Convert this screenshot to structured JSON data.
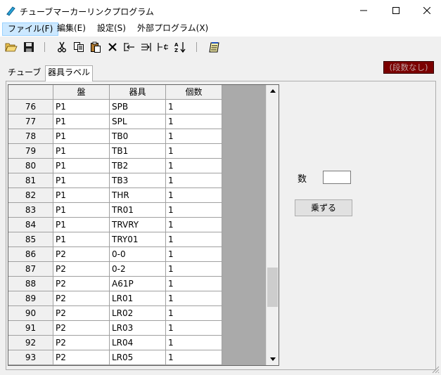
{
  "window": {
    "title": "チューブマーカーリンクプログラム"
  },
  "menu": [
    {
      "label": "ファイル(F)",
      "active": true
    },
    {
      "label": "編集(E)",
      "active": false
    },
    {
      "label": "設定(S)",
      "active": false
    },
    {
      "label": "外部プログラム(X)",
      "active": false
    }
  ],
  "toolbar": {
    "icons": [
      "folder-open-icon",
      "save-icon",
      "cut-icon",
      "copy-icon",
      "paste-icon",
      "delete-icon",
      "insert-row-icon",
      "append-row-icon",
      "delete-row-icon",
      "sort-icon",
      "notepad-icon"
    ]
  },
  "status_badge": "(段数なし)",
  "tabs": [
    {
      "label": "チューブ",
      "active": false
    },
    {
      "label": "器具ラベル",
      "active": true
    }
  ],
  "grid": {
    "columns": [
      "盤",
      "器具",
      "個数"
    ],
    "rows": [
      {
        "no": "76",
        "ban": "P1",
        "kigu": "SPB",
        "kosu": "1"
      },
      {
        "no": "77",
        "ban": "P1",
        "kigu": "SPL",
        "kosu": "1"
      },
      {
        "no": "78",
        "ban": "P1",
        "kigu": "TB0",
        "kosu": "1"
      },
      {
        "no": "79",
        "ban": "P1",
        "kigu": "TB1",
        "kosu": "1"
      },
      {
        "no": "80",
        "ban": "P1",
        "kigu": "TB2",
        "kosu": "1"
      },
      {
        "no": "81",
        "ban": "P1",
        "kigu": "TB3",
        "kosu": "1"
      },
      {
        "no": "82",
        "ban": "P1",
        "kigu": "THR",
        "kosu": "1"
      },
      {
        "no": "83",
        "ban": "P1",
        "kigu": "TR01",
        "kosu": "1"
      },
      {
        "no": "84",
        "ban": "P1",
        "kigu": "TRVRY",
        "kosu": "1"
      },
      {
        "no": "85",
        "ban": "P1",
        "kigu": "TRY01",
        "kosu": "1"
      },
      {
        "no": "86",
        "ban": "P2",
        "kigu": "0-0",
        "kosu": "1"
      },
      {
        "no": "87",
        "ban": "P2",
        "kigu": "0-2",
        "kosu": "1"
      },
      {
        "no": "88",
        "ban": "P2",
        "kigu": "A61P",
        "kosu": "1"
      },
      {
        "no": "89",
        "ban": "P2",
        "kigu": "LR01",
        "kosu": "1"
      },
      {
        "no": "90",
        "ban": "P2",
        "kigu": "LR02",
        "kosu": "1"
      },
      {
        "no": "91",
        "ban": "P2",
        "kigu": "LR03",
        "kosu": "1"
      },
      {
        "no": "92",
        "ban": "P2",
        "kigu": "LR04",
        "kosu": "1"
      },
      {
        "no": "93",
        "ban": "P2",
        "kigu": "LR05",
        "kosu": "1"
      }
    ]
  },
  "side_panel": {
    "count_label": "数",
    "count_value": "",
    "multiply_button": "乗ずる"
  },
  "colors": {
    "status_bg": "#7b0000",
    "menu_active_bg": "#cce8ff",
    "grid_empty": "#aaaaaa"
  }
}
